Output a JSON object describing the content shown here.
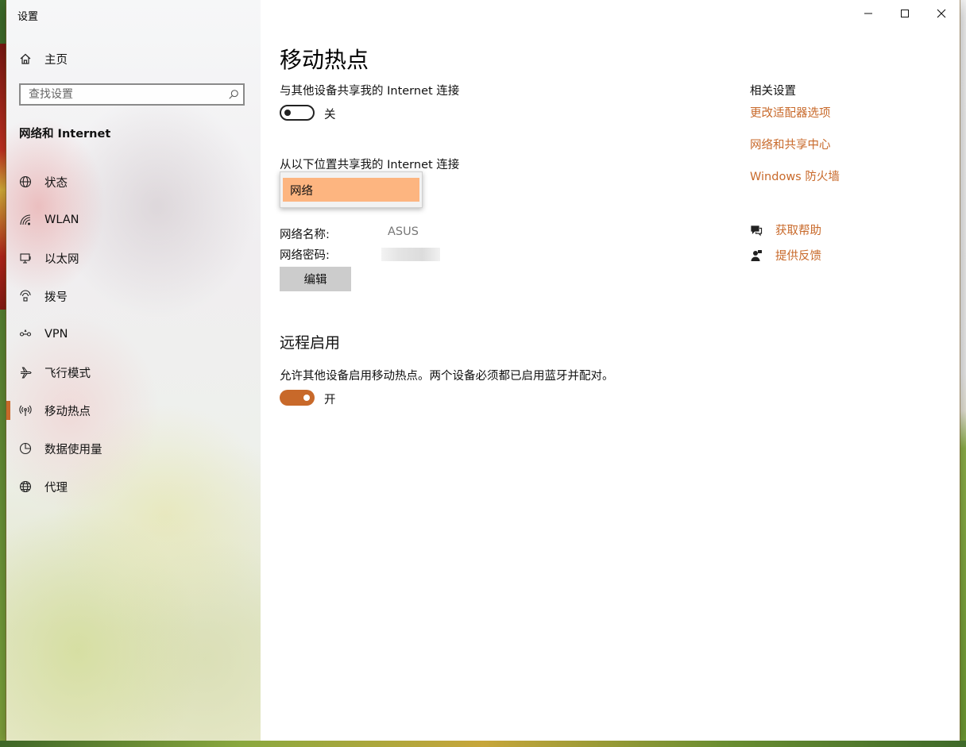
{
  "window": {
    "title": "设置"
  },
  "colors": {
    "accent": "#c8692a",
    "highlight": "#fdb580"
  },
  "sidebar": {
    "home_label": "主页",
    "search_placeholder": "查找设置",
    "section_label": "网络和 Internet",
    "items": [
      {
        "label": "状态",
        "icon": "globe-icon"
      },
      {
        "label": "WLAN",
        "icon": "wifi-icon"
      },
      {
        "label": "以太网",
        "icon": "ethernet-icon"
      },
      {
        "label": "拨号",
        "icon": "dialup-icon"
      },
      {
        "label": "VPN",
        "icon": "vpn-icon"
      },
      {
        "label": "飞行模式",
        "icon": "airplane-icon"
      },
      {
        "label": "移动热点",
        "icon": "hotspot-icon",
        "active": true
      },
      {
        "label": "数据使用量",
        "icon": "data-usage-icon"
      },
      {
        "label": "代理",
        "icon": "proxy-icon"
      }
    ]
  },
  "main": {
    "title": "移动热点",
    "share_label": "与其他设备共享我的 Internet 连接",
    "share_toggle": {
      "state": "off",
      "label": "关"
    },
    "source_label": "从以下位置共享我的 Internet 连接",
    "source_dropdown": {
      "selected": "网络"
    },
    "network_name_label": "网络名称:",
    "network_name_value": "ASUS",
    "network_password_label": "网络密码:",
    "edit_button": "编辑",
    "remote_title": "远程启用",
    "remote_desc": "允许其他设备启用移动热点。两个设备必须都已启用蓝牙并配对。",
    "remote_toggle": {
      "state": "on",
      "label": "开"
    }
  },
  "related": {
    "title": "相关设置",
    "links": [
      "更改适配器选项",
      "网络和共享中心",
      "Windows 防火墙"
    ],
    "help_label": "获取帮助",
    "feedback_label": "提供反馈"
  }
}
